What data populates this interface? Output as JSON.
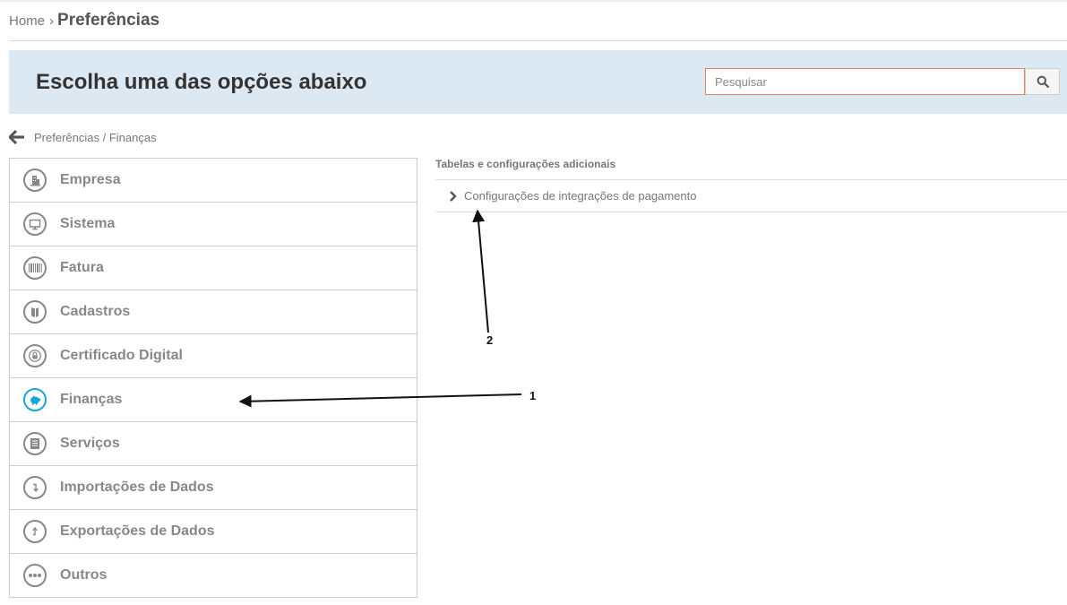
{
  "breadcrumb": {
    "home": "Home",
    "separator": "›",
    "current": "Preferências"
  },
  "banner": {
    "title": "Escolha uma das opções abaixo",
    "search_placeholder": "Pesquisar",
    "search_icon": "search-icon"
  },
  "back_nav": {
    "icon": "arrow-left-icon",
    "path": "Preferências / Finanças"
  },
  "sidebar": {
    "items": [
      {
        "label": "Empresa",
        "icon": "building-icon",
        "active": false
      },
      {
        "label": "Sistema",
        "icon": "monitor-icon",
        "active": false
      },
      {
        "label": "Fatura",
        "icon": "barcode-icon",
        "active": false
      },
      {
        "label": "Cadastros",
        "icon": "book-icon",
        "active": false
      },
      {
        "label": "Certificado Digital",
        "icon": "certificate-lock-icon",
        "active": false
      },
      {
        "label": "Finanças",
        "icon": "piggy-bank-icon",
        "active": true
      },
      {
        "label": "Serviços",
        "icon": "document-list-icon",
        "active": false
      },
      {
        "label": "Importações de Dados",
        "icon": "import-arrow-icon",
        "active": false
      },
      {
        "label": "Exportações de Dados",
        "icon": "export-arrow-icon",
        "active": false
      },
      {
        "label": "Outros",
        "icon": "ellipsis-icon",
        "active": false
      }
    ]
  },
  "panel": {
    "title": "Tabelas e configurações adicionais",
    "items": [
      {
        "label": "Configurações de integrações de pagamento",
        "icon": "chevron-right-icon"
      }
    ]
  },
  "annotations": [
    {
      "label": "1",
      "target": "Finanças"
    },
    {
      "label": "2",
      "target": "Configurações de integrações de pagamento"
    }
  ],
  "colors": {
    "banner_bg": "#dde9f2",
    "active_icon": "#19a3d6",
    "search_border": "#e08060",
    "menu_text": "#888888"
  }
}
